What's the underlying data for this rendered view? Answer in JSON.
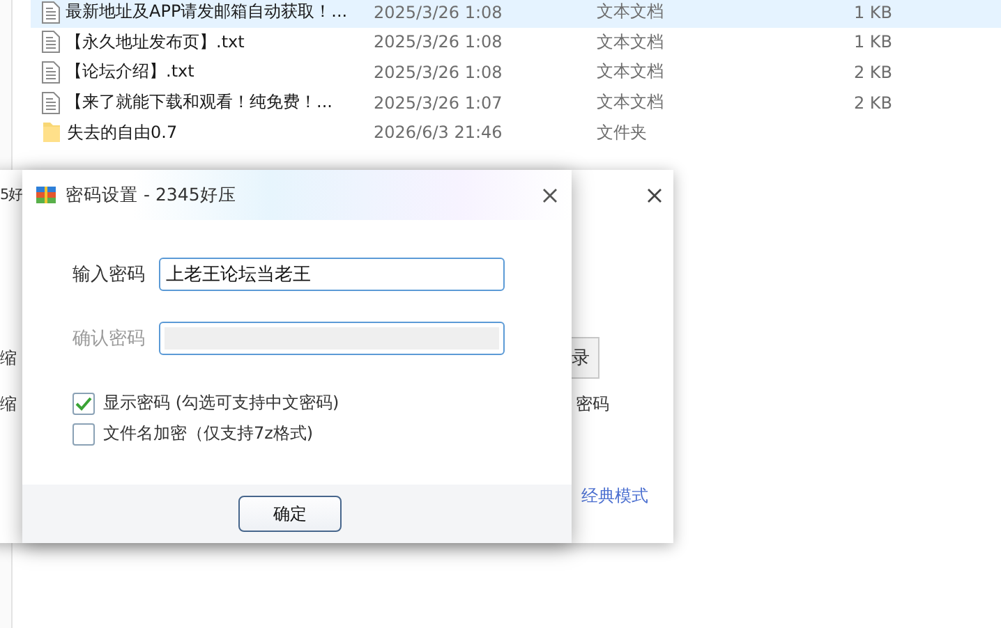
{
  "files": [
    {
      "name": "最新地址及APP请发邮箱自动获取！...",
      "date": "2025/3/26 1:08",
      "type": "文本文档",
      "size": "1 KB",
      "kind": "text",
      "selected": true
    },
    {
      "name": "【永久地址发布页】.txt",
      "date": "2025/3/26 1:08",
      "type": "文本文档",
      "size": "1 KB",
      "kind": "text",
      "selected": false
    },
    {
      "name": "【论坛介绍】.txt",
      "date": "2025/3/26 1:08",
      "type": "文本文档",
      "size": "2 KB",
      "kind": "text",
      "selected": false
    },
    {
      "name": "【来了就能下载和观看！纯免费！...",
      "date": "2025/3/26 1:07",
      "type": "文本文档",
      "size": "2 KB",
      "kind": "text",
      "selected": false
    },
    {
      "name": "失去的自由0.7",
      "date": "2026/6/3 21:46",
      "type": "文件夹",
      "kind": "folder",
      "selected": false
    }
  ],
  "background_window": {
    "title": "5好",
    "label_1": "缩",
    "label_2": "缩",
    "button": "录",
    "option": "密码",
    "link": "经典模式"
  },
  "dialog": {
    "title": "密码设置 - 2345好压",
    "password": {
      "label": "输入密码",
      "value": "上老王论坛当老王",
      "disabled": false
    },
    "confirm": {
      "label": "确认密码",
      "disabled": true
    },
    "options": [
      {
        "label": "显示密码 (勾选可支持中文密码)",
        "checked": true
      },
      {
        "label": "文件名加密（仅支持7z格式)",
        "checked": false
      }
    ],
    "ok_button": "确定"
  }
}
